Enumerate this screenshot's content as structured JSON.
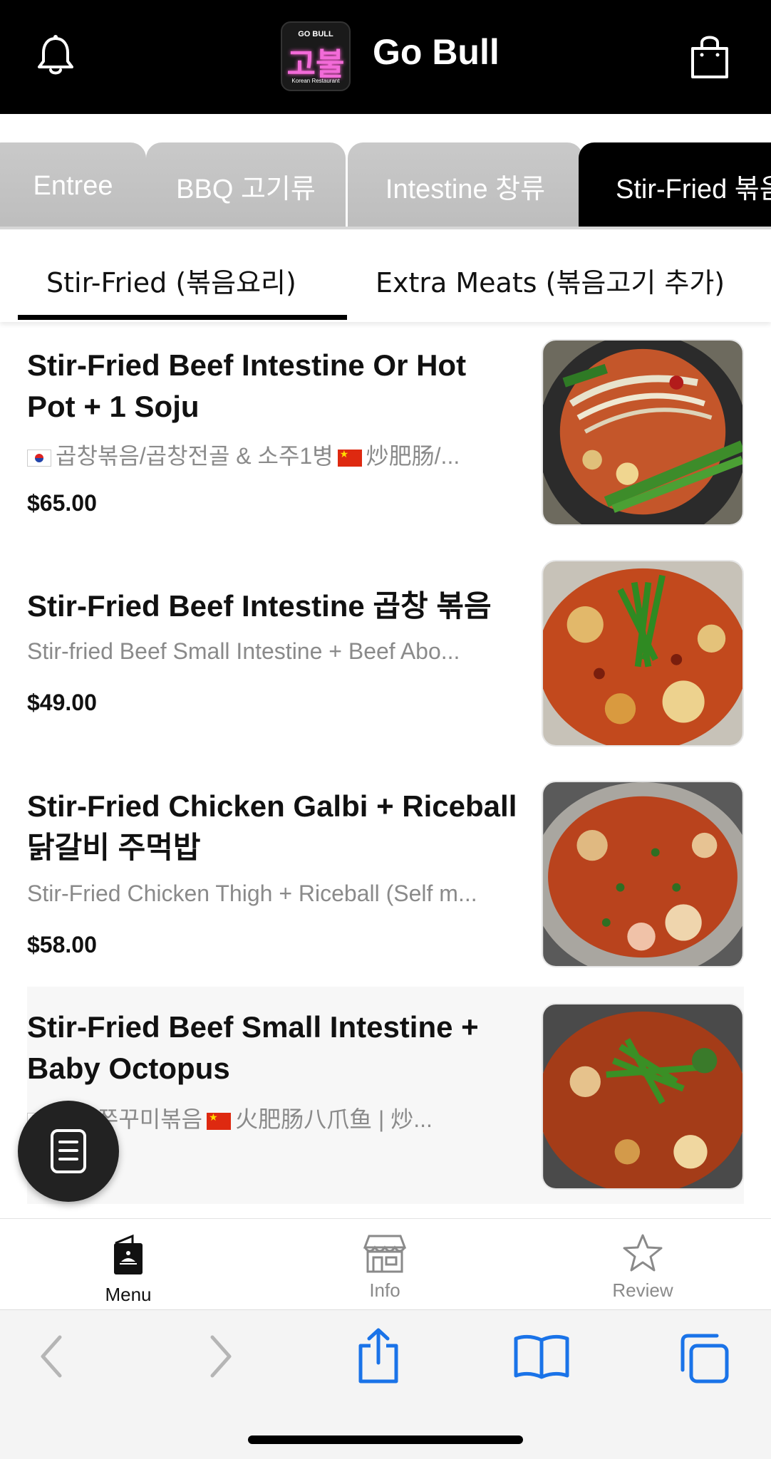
{
  "header": {
    "title": "Go Bull",
    "logo_top": "GO BULL",
    "logo_main": "고불",
    "logo_bottom": "Korean Restaurant",
    "bell_icon": "bell-icon",
    "bag_icon": "shopping-bag-icon"
  },
  "categories": [
    {
      "label": "Entree",
      "active": false
    },
    {
      "label": "BBQ 고기류",
      "active": false
    },
    {
      "label": "Intestine 창류",
      "active": false
    },
    {
      "label": "Stir-Fried 볶음",
      "active": true
    }
  ],
  "subtabs": [
    {
      "label": "Stir-Fried (볶음요리)",
      "active": true
    },
    {
      "label": "Extra Meats (볶음고기 추가)",
      "active": false
    }
  ],
  "items": [
    {
      "name": "Stir-Fried Beef Intestine Or Hot Pot + 1 Soju",
      "desc_kr": "곱창볶음/곱창전골 & 소주1병",
      "desc_cn": "炒肥肠/...",
      "price": "$65.00"
    },
    {
      "name": "Stir-Fried Beef Intestine 곱창 볶음",
      "desc": "Stir-fried Beef Small Intestine + Beef Abo...",
      "price": "$49.00"
    },
    {
      "name": "Stir-Fried Chicken Galbi + Riceball 닭갈비 주먹밥",
      "desc": "Stir-Fried Chicken Thigh + Riceball (Self m...",
      "price": "$58.00"
    },
    {
      "name": "Stir-Fried Beef Small Intestine + Baby Octopus",
      "desc_kr": "곱창쭈꾸미볶음",
      "desc_cn": "火肥肠八爪鱼 | 炒..."
    }
  ],
  "bottom_nav": [
    {
      "label": "Menu",
      "icon": "menu-book-icon"
    },
    {
      "label": "Info",
      "icon": "store-icon"
    },
    {
      "label": "Review",
      "icon": "star-icon"
    }
  ],
  "colors": {
    "header_bg": "#000000",
    "safari_blue": "#1a73e8",
    "gray_tab": "#c4c4c4"
  }
}
